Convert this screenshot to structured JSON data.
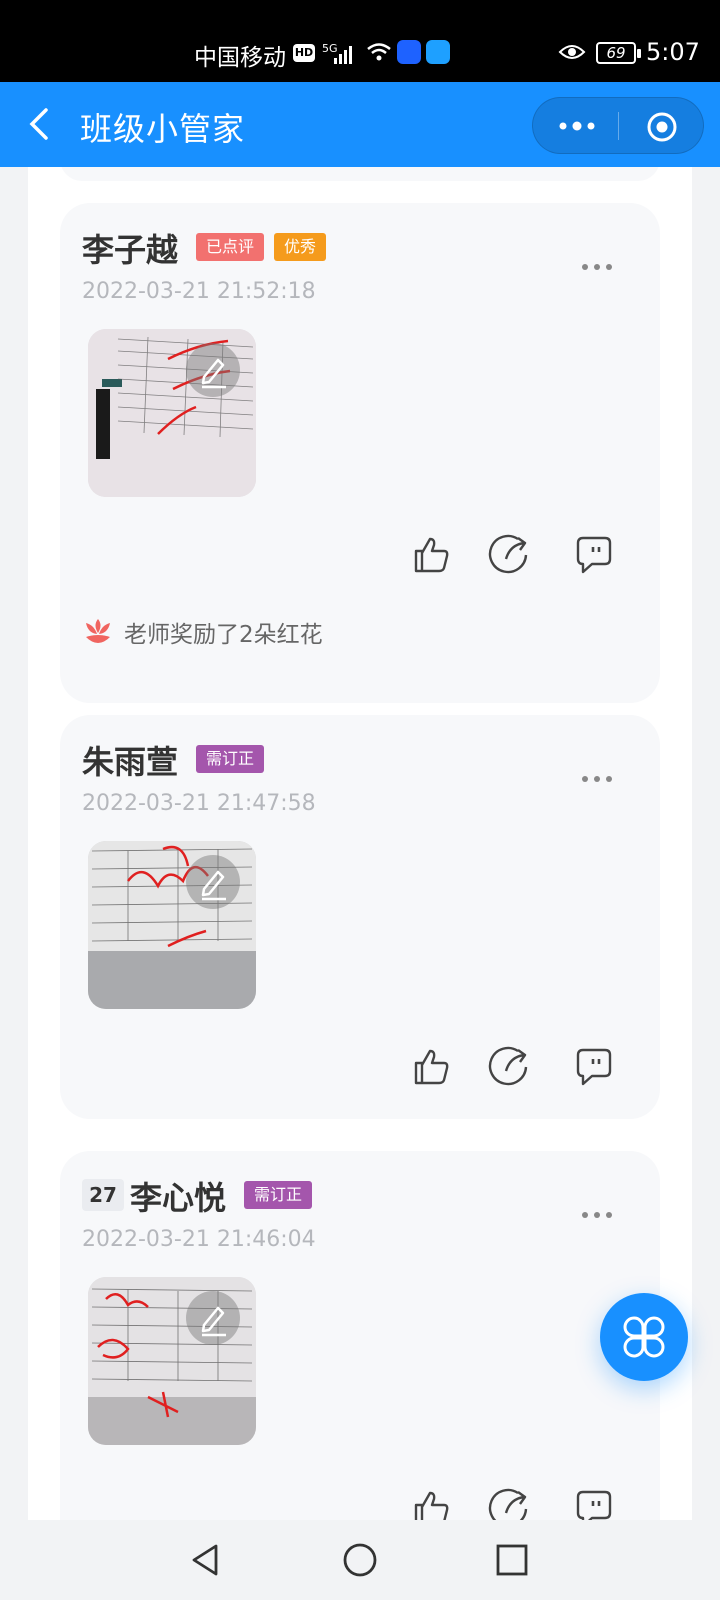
{
  "status_bar": {
    "carrier": "中国移动",
    "hd_label": "HD",
    "network": "5G",
    "battery": "69",
    "time": "5:07"
  },
  "nav_bar": {
    "title": "班级小管家",
    "back_icon": "chevron-left-icon",
    "more_icon": "more-dots-icon",
    "close_icon": "target-close-icon"
  },
  "posts": [
    {
      "name": "李子越",
      "tags": [
        "已点评",
        "优秀"
      ],
      "time": "2022-03-21 21:52:18",
      "reward": "老师奖励了2朵红花"
    },
    {
      "name": "朱雨萱",
      "tags": [
        "需订正"
      ],
      "time": "2022-03-21 21:47:58"
    },
    {
      "number": "27",
      "name": "李心悦",
      "tags": [
        "需订正"
      ],
      "time": "2022-03-21 21:46:04"
    }
  ],
  "colors": {
    "primary": "#1890ff",
    "tag_reviewed": "#f2716f",
    "tag_excellent": "#f59b1c",
    "tag_correction": "#a456ac"
  }
}
